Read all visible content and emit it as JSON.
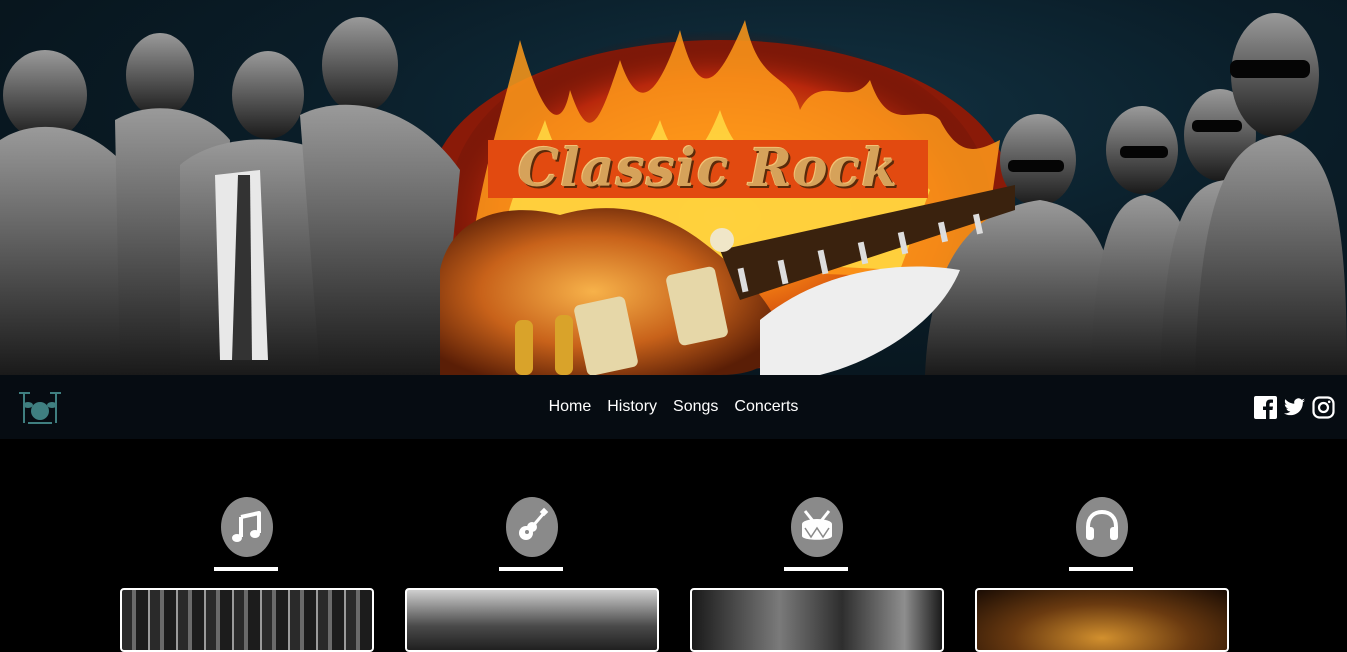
{
  "hero": {
    "logo_text": "Classic Rock"
  },
  "nav": {
    "logo_icon": "drum-kit-icon",
    "links": [
      "Home",
      "History",
      "Songs",
      "Concerts"
    ],
    "socials": [
      "facebook-icon",
      "twitter-icon",
      "instagram-icon"
    ]
  },
  "features": [
    {
      "icon": "music-note-icon"
    },
    {
      "icon": "guitar-icon"
    },
    {
      "icon": "drum-icon"
    },
    {
      "icon": "headphones-icon"
    }
  ],
  "colors": {
    "nav_bg": "#060c12",
    "page_bg": "#000000",
    "icon_circle": "#8a8a8a",
    "logo_bg": "#e24a10"
  }
}
